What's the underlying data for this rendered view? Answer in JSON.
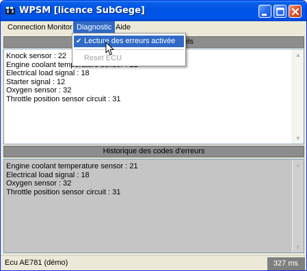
{
  "window": {
    "title": "WPSM [licence SubGege]",
    "app_icon": "app-icon",
    "buttons": {
      "minimize": "minimize-icon",
      "maximize": "maximize-icon",
      "close": "close-icon"
    }
  },
  "menubar": {
    "items": [
      {
        "label": "Connection"
      },
      {
        "label": "Monitor"
      },
      {
        "label": "Diagnostic",
        "active": true
      },
      {
        "label": "Aide"
      }
    ]
  },
  "diagnostic_menu": {
    "items": [
      {
        "label": "Lecture des erreurs activée",
        "checked": true
      },
      {
        "label": "Reset ECU",
        "enabled": false
      }
    ]
  },
  "current_panel": {
    "header": "Codes d'erreurs actuels",
    "lines": [
      "Knock sensor : 22",
      "Engine coolant temperature sensor : 21",
      "Electrical load signal : 18",
      "Starter signal : 12",
      "Oxygen sensor : 32",
      "Throttle position sensor circuit : 31"
    ]
  },
  "history_panel": {
    "header": "Historique des codes d'erreurs",
    "lines": [
      "Engine coolant temperature sensor : 21",
      "Electrical load signal : 18",
      "Oxygen sensor : 32",
      "Throttle position sensor circuit : 31"
    ]
  },
  "statusbar": {
    "ecu": "Ecu AE781 (démo)",
    "timing": "327 ms"
  },
  "colors": {
    "title_bar": "#0054e3",
    "menu_highlight": "#316ac5",
    "panel_header": "#8d8d8d",
    "history_background": "#c5c5c5"
  }
}
